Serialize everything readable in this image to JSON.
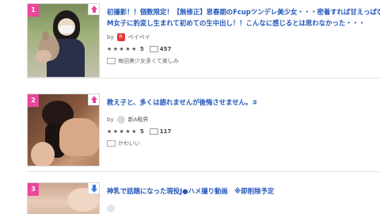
{
  "items": [
    {
      "rank": "1",
      "rank_color": "#e8479a",
      "arrow_color": "#e8479a",
      "title_lines": [
        "初撮影！！個数限定！【無修正】思春期のFcupツンデレ美少女・・・密着すれば甘えっぱなしの",
        "M女子に豹変し生まれて初めての生中出し！！こんなに感じるとは思わなかった・・・"
      ],
      "by": "by",
      "author": "ペイペイ",
      "author_badge": "R",
      "stars": "★★★★★",
      "score": "5",
      "comments": "457",
      "tag": "毎回美少女多くて楽しみ"
    },
    {
      "rank": "2",
      "rank_color": "#e8479a",
      "arrow_color": "#e8479a",
      "title_lines": [
        "教え子と、多くは語れませんが後悔させません。②"
      ],
      "by": "by",
      "author": "新A租界",
      "author_badge": "",
      "stars": "★★★★★",
      "score": "5",
      "comments": "117",
      "tag": "かわいい"
    },
    {
      "rank": "3",
      "rank_color": "#e8479a",
      "arrow_color": "#3b7dd8",
      "title_lines": [
        "神乳で話題になった現役J●ハメ撮り動画　※即削除予定"
      ],
      "by": "",
      "author": "",
      "author_badge": "",
      "stars": "",
      "score": "",
      "comments": "",
      "tag": ""
    }
  ]
}
